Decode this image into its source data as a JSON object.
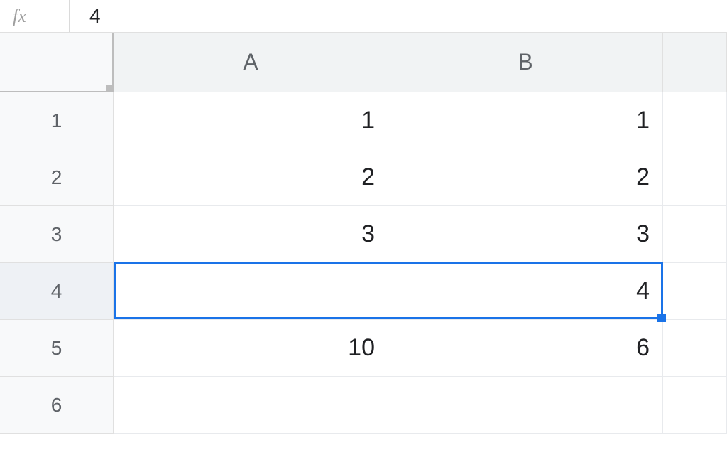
{
  "formula_bar": {
    "fx_label": "fx",
    "value": "4"
  },
  "columns": [
    "A",
    "B"
  ],
  "rows": [
    "1",
    "2",
    "3",
    "4",
    "5",
    "6"
  ],
  "cells": {
    "A1": "1",
    "B1": "1",
    "A2": "2",
    "B2": "2",
    "A3": "3",
    "B3": "3",
    "A4": "",
    "B4": "4",
    "A5": "10",
    "B5": "6",
    "A6": "",
    "B6": ""
  },
  "selection": {
    "range": "A4:B4",
    "active_row": "4"
  }
}
